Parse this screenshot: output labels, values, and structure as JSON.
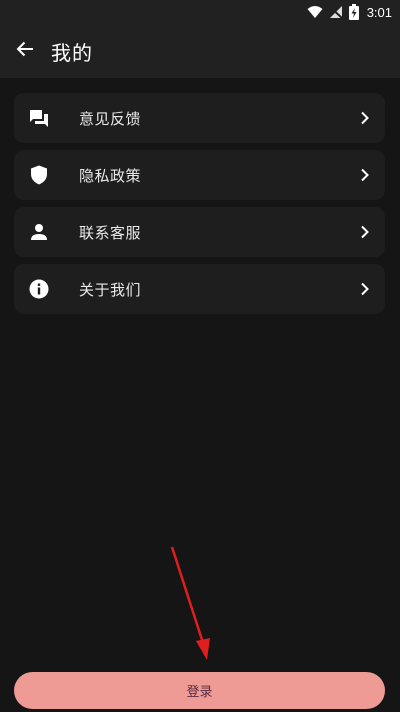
{
  "status_bar": {
    "time": "3:01",
    "icons": [
      "wifi-icon",
      "no-signal-icon",
      "battery-charging-icon"
    ]
  },
  "header": {
    "title": "我的",
    "back_icon": "arrow-left-icon"
  },
  "menu": {
    "items": [
      {
        "label": "意见反馈",
        "icon": "chat-feedback-icon"
      },
      {
        "label": "隐私政策",
        "icon": "shield-icon"
      },
      {
        "label": "联系客服",
        "icon": "person-icon"
      },
      {
        "label": "关于我们",
        "icon": "info-icon"
      }
    ],
    "chevron_icon": "chevron-right-icon"
  },
  "login": {
    "label": "登录"
  },
  "colors": {
    "background": "#151515",
    "bar": "#212121",
    "card": "#1e1e1e",
    "login_button": "#ee9a95",
    "login_text": "#5a2a40",
    "annotation_arrow": "#e01e1e"
  }
}
